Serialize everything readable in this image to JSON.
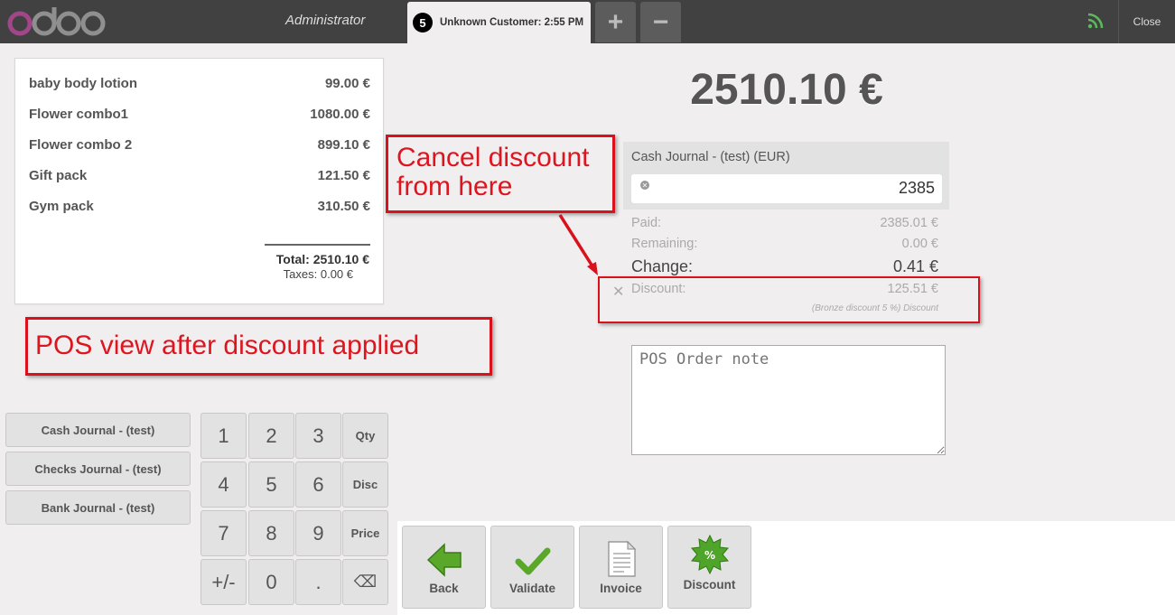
{
  "header": {
    "logo_text": "odoo",
    "user": "Administrator",
    "order": {
      "number": "5",
      "label": "Unknown Customer: 2:55 PM"
    },
    "add_order_label": "+",
    "remove_order_label": "−",
    "close_label": "Close",
    "network_icon": "wifi-signal-icon",
    "colors": {
      "bar": "#414141",
      "network": "#5cb85c"
    }
  },
  "receipt": {
    "lines": [
      {
        "name": "baby body lotion",
        "price": "99.00 €"
      },
      {
        "name": "Flower combo1",
        "price": "1080.00 €"
      },
      {
        "name": "Flower combo 2",
        "price": "899.10 €"
      },
      {
        "name": "Gift pack",
        "price": "121.50 €"
      },
      {
        "name": "Gym pack",
        "price": "310.50 €"
      }
    ],
    "total": "Total: 2510.10 €",
    "taxes": "Taxes: 0.00 €"
  },
  "annotations": {
    "pos_view": "POS view after discount applied",
    "cancel_discount": "Cancel discount\nfrom here",
    "color": "#e0141e"
  },
  "journals": [
    "Cash Journal - (test)",
    "Checks Journal - (test)",
    "Bank Journal - (test)"
  ],
  "numpad": {
    "keys": [
      "1",
      "2",
      "3",
      "Qty",
      "4",
      "5",
      "6",
      "Disc",
      "7",
      "8",
      "9",
      "Price",
      "+/-",
      "0",
      ".",
      "⌫"
    ]
  },
  "payment": {
    "due": "2510.10 €",
    "line_journal": "Cash Journal - (test) (EUR)",
    "line_amount": "2385",
    "paid_label": "Paid:",
    "paid_value": "2385.01 €",
    "remaining_label": "Remaining:",
    "remaining_value": "0.00 €",
    "change_label": "Change:",
    "change_value": "0.41 €",
    "discount_label": "Discount:",
    "discount_value": "125.51 €",
    "discount_note": "(Bronze discount 5 %) Discount",
    "note_placeholder": "POS Order note"
  },
  "actions": {
    "back": "Back",
    "validate": "Validate",
    "invoice": "Invoice",
    "discount": "Discount",
    "discount_badge": "%",
    "icons": {
      "back": "green-left-arrow-icon",
      "validate": "green-checkmark-icon",
      "invoice": "document-icon",
      "discount": "green-starburst-percent-icon"
    },
    "colors": {
      "green": "#5aa82a"
    }
  }
}
